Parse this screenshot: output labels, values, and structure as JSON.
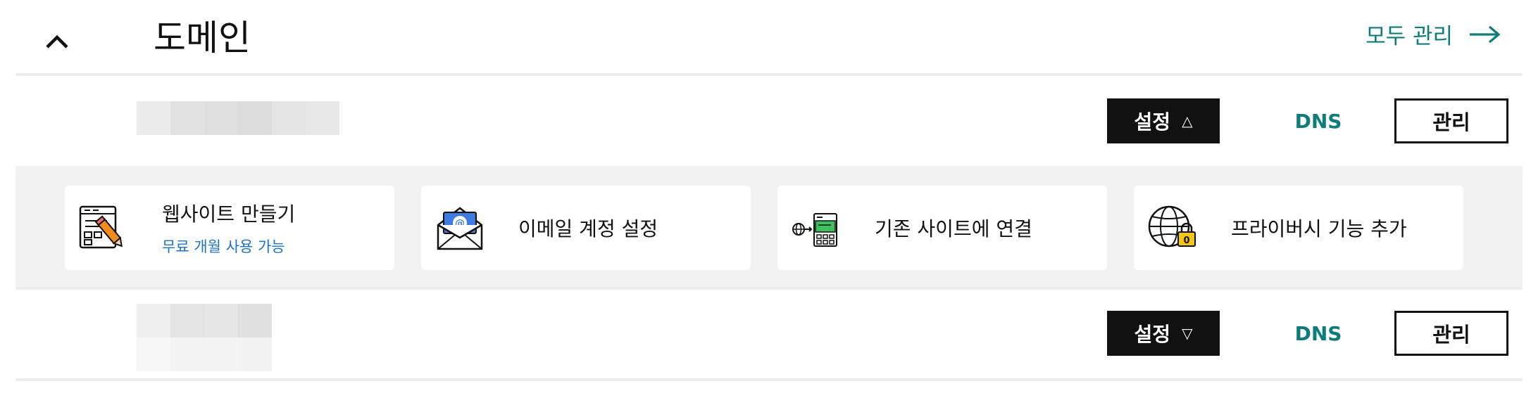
{
  "header": {
    "title": "도메인",
    "manage_all_label": "모두 관리"
  },
  "domains": [
    {
      "settings_label": "설정",
      "settings_state": "expanded",
      "dns_label": "DNS",
      "manage_label": "관리"
    },
    {
      "settings_label": "설정",
      "settings_state": "collapsed",
      "dns_label": "DNS",
      "manage_label": "관리"
    }
  ],
  "setup_cards": [
    {
      "title": "웹사이트 만들기",
      "subtitle": "무료 개월 사용 가능",
      "icon": "website-builder-icon"
    },
    {
      "title": "이메일 계정 설정",
      "subtitle": "",
      "icon": "email-icon"
    },
    {
      "title": "기존 사이트에 연결",
      "subtitle": "",
      "icon": "connect-site-icon"
    },
    {
      "title": "프라이버시 기능 추가",
      "subtitle": "",
      "icon": "privacy-globe-lock-icon"
    }
  ],
  "colors": {
    "accent_teal": "#0e7c7b",
    "link_blue": "#1a73c9",
    "button_dark": "#111111",
    "panel_bg": "#f2f2f2"
  }
}
